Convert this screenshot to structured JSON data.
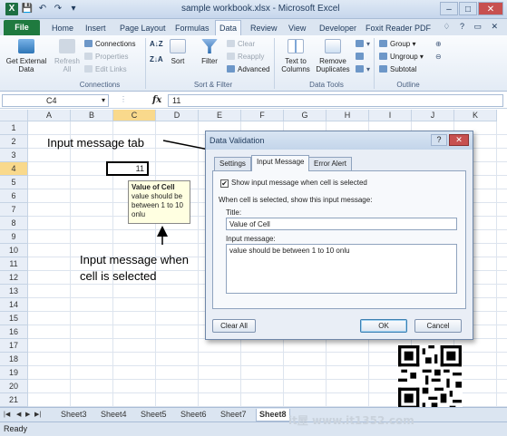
{
  "window": {
    "title": "sample workbook.xlsx - Microsoft Excel",
    "controls": [
      "–",
      "□",
      "✕"
    ]
  },
  "tabs": {
    "file": "File",
    "items": [
      "Home",
      "Insert",
      "Page Layout",
      "Formulas",
      "Data",
      "Review",
      "View",
      "Developer",
      "Foxit Reader PDF"
    ],
    "active": "Data"
  },
  "ribbon": {
    "get_external": "Get External Data",
    "refresh": "Refresh All",
    "connections": "Connections",
    "properties": "Properties",
    "edit_links": "Edit Links",
    "group_connections": "Connections",
    "sort_az": "A↓Z",
    "sort_za": "Z↓A",
    "sort": "Sort",
    "filter": "Filter",
    "clear": "Clear",
    "reapply": "Reapply",
    "advanced": "Advanced",
    "group_sortfilter": "Sort & Filter",
    "text_to_columns": "Text to Columns",
    "remove_duplicates": "Remove Duplicates",
    "group_datatools": "Data Tools",
    "group": "Group",
    "ungroup": "Ungroup",
    "subtotal": "Subtotal",
    "group_outline": "Outline"
  },
  "formula_bar": {
    "name_box": "C4",
    "fx": "fx",
    "value": "11"
  },
  "grid": {
    "columns": [
      "A",
      "B",
      "C",
      "D",
      "E",
      "F",
      "G",
      "H",
      "I",
      "J",
      "K"
    ],
    "rows": [
      "1",
      "2",
      "3",
      "4",
      "5",
      "6",
      "7",
      "8",
      "9",
      "10",
      "11",
      "12",
      "13",
      "14",
      "15",
      "16",
      "17",
      "18",
      "19",
      "20",
      "21"
    ],
    "active_cell_value": "11"
  },
  "input_tooltip": {
    "title": "Value of Cell",
    "message": "value should be between 1 to 10 onlu"
  },
  "annotations": {
    "tab_label": "Input message tab",
    "cell_label": "Input message when cell is selected"
  },
  "dialog": {
    "title": "Data Validation",
    "help": "?",
    "close": "✕",
    "tabs": [
      "Settings",
      "Input Message",
      "Error Alert"
    ],
    "active_tab": "Input Message",
    "show_checkbox_label": "Show input message when cell is selected",
    "checked": "✔",
    "when_selected_label": "When cell is selected, show this input message:",
    "title_label": "Title:",
    "title_value": "Value of Cell",
    "message_label": "Input message:",
    "message_value": "value should be between 1 to 10 onlu",
    "clear_all": "Clear All",
    "ok": "OK",
    "cancel": "Cancel"
  },
  "sheets": {
    "tabs": [
      "Sheet3",
      "Sheet4",
      "Sheet5",
      "Sheet6",
      "Sheet7",
      "Sheet8"
    ],
    "active": "Sheet8"
  },
  "status": {
    "text": "Ready"
  },
  "watermark": "it屋  www.it1352.com"
}
